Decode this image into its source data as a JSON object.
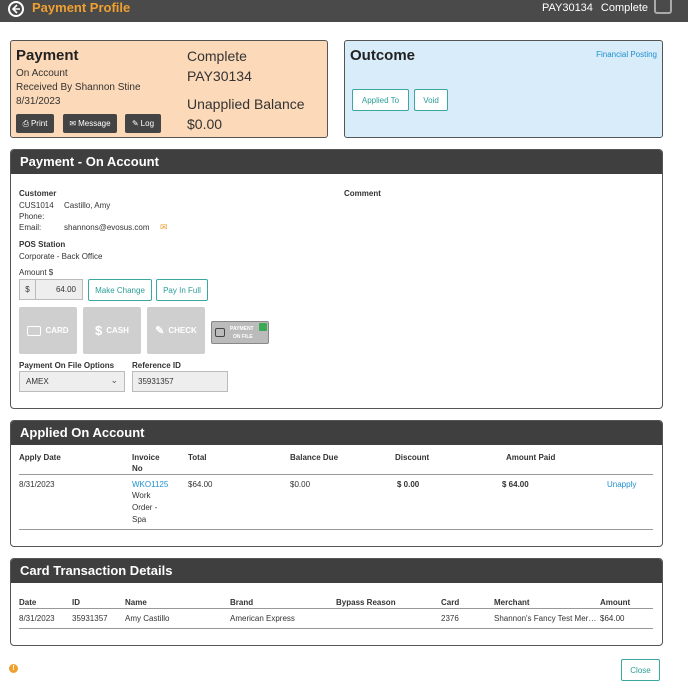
{
  "topbar": {
    "title": "Payment Profile",
    "id": "PAY30134",
    "status": "Complete"
  },
  "payment_card": {
    "heading": "Payment",
    "type": "On Account",
    "received_by": "Received By Shannon Stine",
    "date": "8/31/2023",
    "status": "Complete",
    "id": "PAY30134",
    "unapplied_label": "Unapplied Balance",
    "unapplied_value": "$0.00",
    "buttons": {
      "print": "Print",
      "message": "Message",
      "log": "Log"
    }
  },
  "outcome_card": {
    "heading": "Outcome",
    "link": "Financial Posting",
    "buttons": {
      "applied_to": "Applied To",
      "void": "Void"
    }
  },
  "payment_panel": {
    "title": "Payment - On Account",
    "customer_label": "Customer",
    "customer_id": "CUS1014",
    "customer_name": "Castillo, Amy",
    "phone_label": "Phone:",
    "email_label": "Email:",
    "email_value": "shannons@evosus.com",
    "comment_label": "Comment",
    "pos_label": "POS Station",
    "pos_value": "Corporate - Back Office",
    "amount_label": "Amount $",
    "currency_symbol": "$",
    "amount_value": "64.00",
    "make_change": "Make Change",
    "pay_in_full": "Pay In Full",
    "methods": {
      "card": "CARD",
      "cash": "CASH",
      "check": "CHECK",
      "on_file_1": "PAYMENT",
      "on_file_2": "ON FILE"
    },
    "pof_label": "Payment On File Options",
    "pof_value": "AMEX",
    "ref_label": "Reference ID",
    "ref_value": "35931357"
  },
  "applied_panel": {
    "title": "Applied On Account",
    "headers": {
      "apply_date": "Apply Date",
      "invoice_1": "Invoice",
      "invoice_2": "No",
      "total": "Total",
      "balance_due": "Balance Due",
      "discount": "Discount",
      "amount_paid": "Amount Paid"
    },
    "row": {
      "apply_date": "8/31/2023",
      "invoice_no": "WKO1125",
      "desc_1": "Work",
      "desc_2": "Order -",
      "desc_3": "Spa",
      "total": "$64.00",
      "balance_due": "$0.00",
      "discount": "$ 0.00",
      "amount_paid": "$ 64.00",
      "action": "Unapply"
    }
  },
  "card_panel": {
    "title": "Card Transaction Details",
    "headers": {
      "date": "Date",
      "id": "ID",
      "name": "Name",
      "brand": "Brand",
      "bypass": "Bypass Reason",
      "card": "Card",
      "merchant": "Merchant",
      "amount": "Amount"
    },
    "row": {
      "date": "8/31/2023",
      "id": "35931357",
      "name": "Amy Castillo",
      "brand": "American Express",
      "bypass": "",
      "card": "2376",
      "merchant": "Shannon's Fancy Test Mer…",
      "amount": "$64.00"
    }
  },
  "footer": {
    "close": "Close"
  },
  "colors": {
    "accent": "#f0a030",
    "teal": "#2a9d95",
    "link": "#1e90d0"
  }
}
